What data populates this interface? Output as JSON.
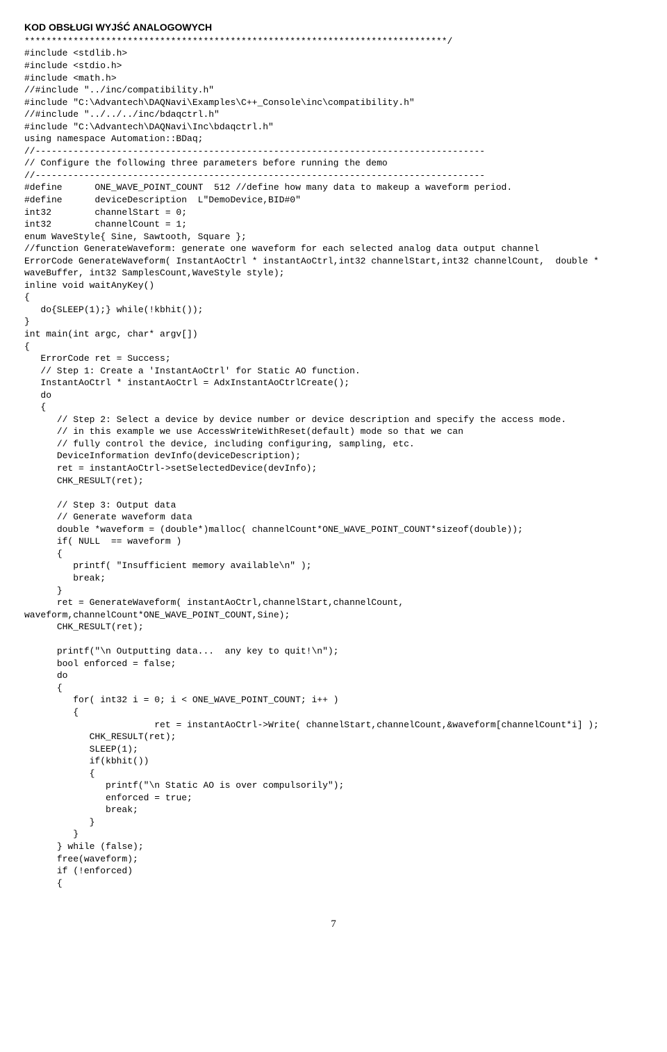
{
  "title": "KOD OBSŁUGI WYJŚĆ ANALOGOWYCH",
  "code": "******************************************************************************/\n#include <stdlib.h>\n#include <stdio.h>\n#include <math.h>\n//#include \"../inc/compatibility.h\"\n#include \"C:\\Advantech\\DAQNavi\\Examples\\C++_Console\\inc\\compatibility.h\"\n//#include \"../../../inc/bdaqctrl.h\"\n#include \"C:\\Advantech\\DAQNavi\\Inc\\bdaqctrl.h\"\nusing namespace Automation::BDaq;\n//-----------------------------------------------------------------------------------\n// Configure the following three parameters before running the demo\n//-----------------------------------------------------------------------------------\n#define      ONE_WAVE_POINT_COUNT  512 //define how many data to makeup a waveform period.\n#define      deviceDescription  L\"DemoDevice,BID#0\"\nint32        channelStart = 0;\nint32        channelCount = 1;\nenum WaveStyle{ Sine, Sawtooth, Square };\n//function GenerateWaveform: generate one waveform for each selected analog data output channel\nErrorCode GenerateWaveform( InstantAoCtrl * instantAoCtrl,int32 channelStart,int32 channelCount,  double * waveBuffer, int32 SamplesCount,WaveStyle style);\ninline void waitAnyKey()\n{\n   do{SLEEP(1);} while(!kbhit());\n}\nint main(int argc, char* argv[])\n{\n   ErrorCode ret = Success;\n   // Step 1: Create a 'InstantAoCtrl' for Static AO function.\n   InstantAoCtrl * instantAoCtrl = AdxInstantAoCtrlCreate();\n   do\n   {\n      // Step 2: Select a device by device number or device description and specify the access mode.\n      // in this example we use AccessWriteWithReset(default) mode so that we can\n      // fully control the device, including configuring, sampling, etc.\n      DeviceInformation devInfo(deviceDescription);\n      ret = instantAoCtrl->setSelectedDevice(devInfo);\n      CHK_RESULT(ret);\n\n      // Step 3: Output data\n      // Generate waveform data\n      double *waveform = (double*)malloc( channelCount*ONE_WAVE_POINT_COUNT*sizeof(double));\n      if( NULL  == waveform )\n      {\n         printf( \"Insufficient memory available\\n\" );\n         break;\n      }\n      ret = GenerateWaveform( instantAoCtrl,channelStart,channelCount, waveform,channelCount*ONE_WAVE_POINT_COUNT,Sine);\n      CHK_RESULT(ret);\n\n      printf(\"\\n Outputting data...  any key to quit!\\n\");\n      bool enforced = false;\n      do\n      {\n         for( int32 i = 0; i < ONE_WAVE_POINT_COUNT; i++ )\n         {\n                        ret = instantAoCtrl->Write( channelStart,channelCount,&waveform[channelCount*i] );\n            CHK_RESULT(ret);\n            SLEEP(1);\n            if(kbhit())\n            {\n               printf(\"\\n Static AO is over compulsorily\");\n               enforced = true;\n               break;\n            }\n         }\n      } while (false);\n      free(waveform);\n      if (!enforced)\n      {",
  "pageNumber": "7"
}
